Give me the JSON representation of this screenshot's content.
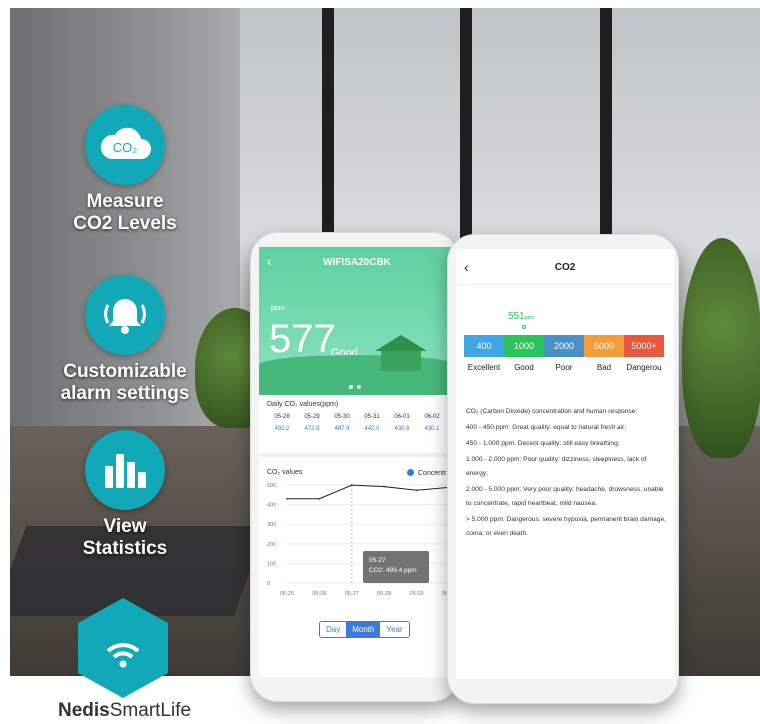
{
  "features": [
    {
      "label": "Measure\nCO2 Levels",
      "icon": "co2-cloud-icon",
      "badge": "CO₂"
    },
    {
      "label": "Customizable\nalarm settings",
      "icon": "bell-alarm-icon"
    },
    {
      "label": "View\nStatistics",
      "icon": "bar-chart-icon"
    }
  ],
  "brand": {
    "name_bold": "Nedis",
    "name_light": "SmartLife",
    "icon": "wifi-home-icon"
  },
  "colors": {
    "accent": "#11a9b8",
    "green": "#2bc35c",
    "blue": "#3a7bd5"
  },
  "left_phone": {
    "device_title": "WIFISA20CBK",
    "unit": "ppm",
    "value": "577",
    "quality": "Good",
    "daily_title": "Daily CO₂ values(ppm)",
    "daily_dates": [
      "05-28",
      "05-29",
      "05-30",
      "05-31",
      "06-01",
      "06-02"
    ],
    "daily_values": [
      "492.2",
      "472.9",
      "487.9",
      "442.0",
      "430.8",
      "430.1"
    ],
    "chart_title": "CO₂ values",
    "legend_label": "Concentr",
    "tooltip_date": "05-27",
    "tooltip_value": "CO2: 499.4 ppm",
    "tabs": [
      "Day",
      "Month",
      "Year"
    ],
    "active_tab": "Month"
  },
  "chart_data": {
    "type": "line",
    "x": [
      "05-25",
      "05-26",
      "05-27",
      "05-28",
      "05-29",
      "05-30"
    ],
    "values": [
      430,
      430,
      499.4,
      492,
      473,
      488
    ],
    "yticks": [
      "500",
      "400",
      "300",
      "200",
      "100",
      "0"
    ],
    "ylim": [
      0,
      500
    ],
    "title": "CO₂ values"
  },
  "right_phone": {
    "title": "CO2",
    "pointer_value": "551",
    "pointer_unit": "ppm",
    "levels": [
      {
        "value": "400",
        "label": "Excellent",
        "color": "#3fa7e6"
      },
      {
        "value": "1000",
        "label": "Good",
        "color": "#2bc35c"
      },
      {
        "value": "2000",
        "label": "Poor",
        "color": "#4a90c8"
      },
      {
        "value": "5000",
        "label": "Bad",
        "color": "#f39c3a"
      },
      {
        "value": "5000+",
        "label": "Dangerou",
        "color": "#e8583f"
      }
    ],
    "info": [
      "CO₂ (Carbon Dioxide) concentration and human response:",
      "400 - 450 ppm: Great quality: equal to natural fresh air;",
      "450 - 1.000 ppm: Decent quality: still easy breathing;",
      "1.000 - 2.000 ppm: Poor quality: dizziness, sleepiness, lack of energy;",
      "2.000 - 5.000 ppm: Very poor quality: headache, drowsness, unable to concentrate, rapid heartbeat, mild nausea;",
      "> 5.000 ppm: Dangerous: severe hypoxia, permanent brain damage, coma, or even death."
    ]
  }
}
